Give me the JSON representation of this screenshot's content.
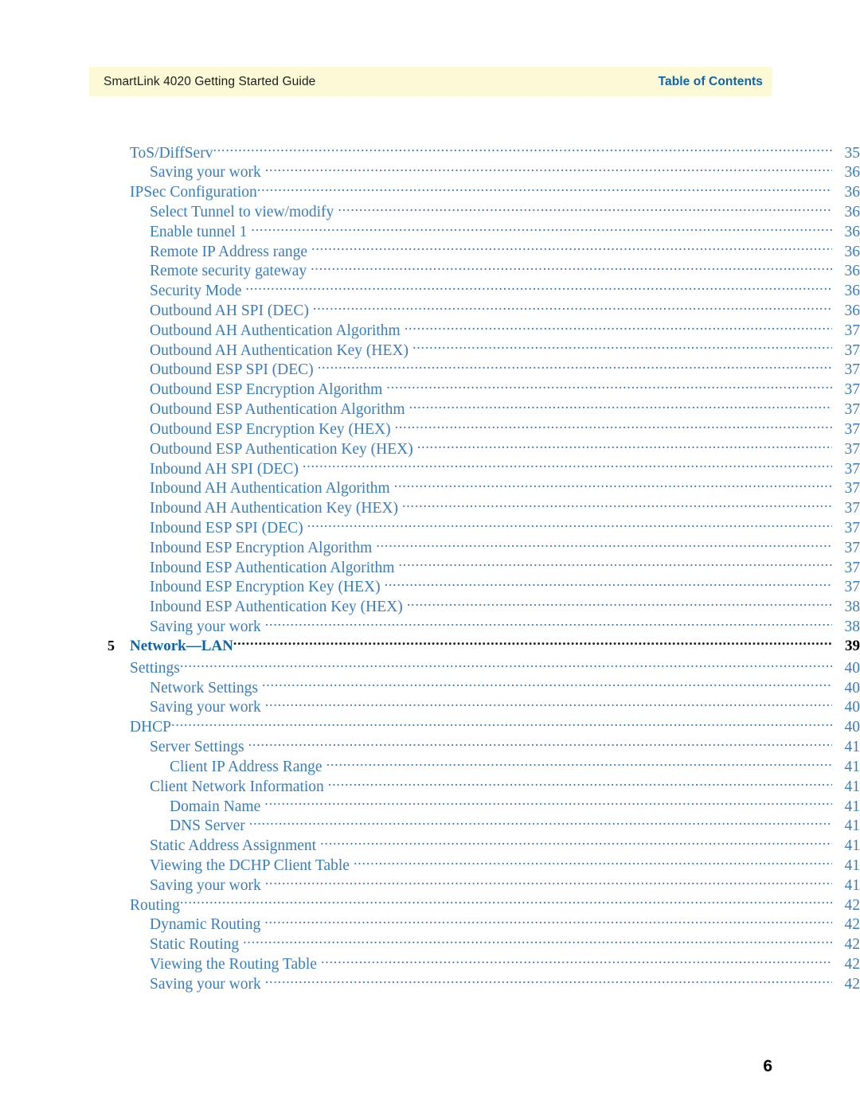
{
  "header": {
    "doc_title": "SmartLink 4020 Getting Started Guide",
    "section_title": "Table of Contents",
    "band_color": "#fcfad6",
    "accent_color": "#0f63ac"
  },
  "colors": {
    "toc_text": "#3a7dbe",
    "heading_blue": "#0f63ac",
    "black": "#000000"
  },
  "toc": {
    "entries": [
      {
        "chapter": "",
        "label": "ToS/DiffServ",
        "page": "35",
        "level": 1,
        "bold": false
      },
      {
        "chapter": "",
        "label": "Saving your work",
        "page": "36",
        "level": 2,
        "bold": false
      },
      {
        "chapter": "",
        "label": "IPSec Configuration",
        "page": "36",
        "level": 1,
        "bold": false
      },
      {
        "chapter": "",
        "label": "Select Tunnel to view/modify",
        "page": "36",
        "level": 2,
        "bold": false
      },
      {
        "chapter": "",
        "label": "Enable tunnel 1",
        "page": "36",
        "level": 2,
        "bold": false
      },
      {
        "chapter": "",
        "label": "Remote IP Address range",
        "page": "36",
        "level": 2,
        "bold": false
      },
      {
        "chapter": "",
        "label": "Remote security gateway",
        "page": "36",
        "level": 2,
        "bold": false
      },
      {
        "chapter": "",
        "label": "Security Mode",
        "page": "36",
        "level": 2,
        "bold": false
      },
      {
        "chapter": "",
        "label": "Outbound AH SPI (DEC)",
        "page": "36",
        "level": 2,
        "bold": false
      },
      {
        "chapter": "",
        "label": "Outbound AH Authentication Algorithm",
        "page": "37",
        "level": 2,
        "bold": false
      },
      {
        "chapter": "",
        "label": "Outbound AH Authentication Key (HEX)",
        "page": "37",
        "level": 2,
        "bold": false
      },
      {
        "chapter": "",
        "label": "Outbound ESP SPI (DEC)",
        "page": "37",
        "level": 2,
        "bold": false
      },
      {
        "chapter": "",
        "label": "Outbound ESP Encryption Algorithm",
        "page": "37",
        "level": 2,
        "bold": false
      },
      {
        "chapter": "",
        "label": "Outbound ESP Authentication Algorithm",
        "page": "37",
        "level": 2,
        "bold": false
      },
      {
        "chapter": "",
        "label": "Outbound ESP Encryption Key (HEX)",
        "page": "37",
        "level": 2,
        "bold": false
      },
      {
        "chapter": "",
        "label": "Outbound ESP Authentication Key (HEX)",
        "page": "37",
        "level": 2,
        "bold": false
      },
      {
        "chapter": "",
        "label": "Inbound AH SPI (DEC)",
        "page": "37",
        "level": 2,
        "bold": false
      },
      {
        "chapter": "",
        "label": "Inbound AH Authentication Algorithm",
        "page": "37",
        "level": 2,
        "bold": false
      },
      {
        "chapter": "",
        "label": "Inbound AH Authentication Key (HEX)",
        "page": "37",
        "level": 2,
        "bold": false
      },
      {
        "chapter": "",
        "label": "Inbound ESP SPI (DEC)",
        "page": "37",
        "level": 2,
        "bold": false
      },
      {
        "chapter": "",
        "label": "Inbound ESP Encryption Algorithm",
        "page": "37",
        "level": 2,
        "bold": false
      },
      {
        "chapter": "",
        "label": "Inbound ESP Authentication Algorithm",
        "page": "37",
        "level": 2,
        "bold": false
      },
      {
        "chapter": "",
        "label": "Inbound ESP Encryption Key (HEX)",
        "page": "37",
        "level": 2,
        "bold": false
      },
      {
        "chapter": "",
        "label": "Inbound ESP Authentication Key (HEX)",
        "page": "38",
        "level": 2,
        "bold": false
      },
      {
        "chapter": "",
        "label": "Saving your work",
        "page": "38",
        "level": 2,
        "bold": false
      },
      {
        "chapter": "5",
        "label": "Network—LAN",
        "page": "39",
        "level": 1,
        "bold": true
      },
      {
        "chapter": "",
        "label": "Settings",
        "page": "40",
        "level": 1,
        "bold": false
      },
      {
        "chapter": "",
        "label": "Network Settings",
        "page": "40",
        "level": 2,
        "bold": false
      },
      {
        "chapter": "",
        "label": "Saving your work",
        "page": "40",
        "level": 2,
        "bold": false
      },
      {
        "chapter": "",
        "label": "DHCP",
        "page": "40",
        "level": 1,
        "bold": false
      },
      {
        "chapter": "",
        "label": "Server Settings",
        "page": "41",
        "level": 2,
        "bold": false
      },
      {
        "chapter": "",
        "label": "Client IP Address Range",
        "page": "41",
        "level": 3,
        "bold": false
      },
      {
        "chapter": "",
        "label": "Client Network Information",
        "page": "41",
        "level": 2,
        "bold": false
      },
      {
        "chapter": "",
        "label": "Domain Name",
        "page": "41",
        "level": 3,
        "bold": false
      },
      {
        "chapter": "",
        "label": "DNS Server",
        "page": "41",
        "level": 3,
        "bold": false
      },
      {
        "chapter": "",
        "label": "Static Address Assignment",
        "page": "41",
        "level": 2,
        "bold": false
      },
      {
        "chapter": "",
        "label": "Viewing the DCHP Client Table",
        "page": "41",
        "level": 2,
        "bold": false
      },
      {
        "chapter": "",
        "label": "Saving your work",
        "page": "41",
        "level": 2,
        "bold": false
      },
      {
        "chapter": "",
        "label": "Routing",
        "page": "42",
        "level": 1,
        "bold": false
      },
      {
        "chapter": "",
        "label": "Dynamic Routing",
        "page": "42",
        "level": 2,
        "bold": false
      },
      {
        "chapter": "",
        "label": "Static Routing",
        "page": "42",
        "level": 2,
        "bold": false
      },
      {
        "chapter": "",
        "label": "Viewing the Routing Table",
        "page": "42",
        "level": 2,
        "bold": false
      },
      {
        "chapter": "",
        "label": "Saving your work",
        "page": "42",
        "level": 2,
        "bold": false
      }
    ]
  },
  "folio": {
    "page_number": "6"
  }
}
